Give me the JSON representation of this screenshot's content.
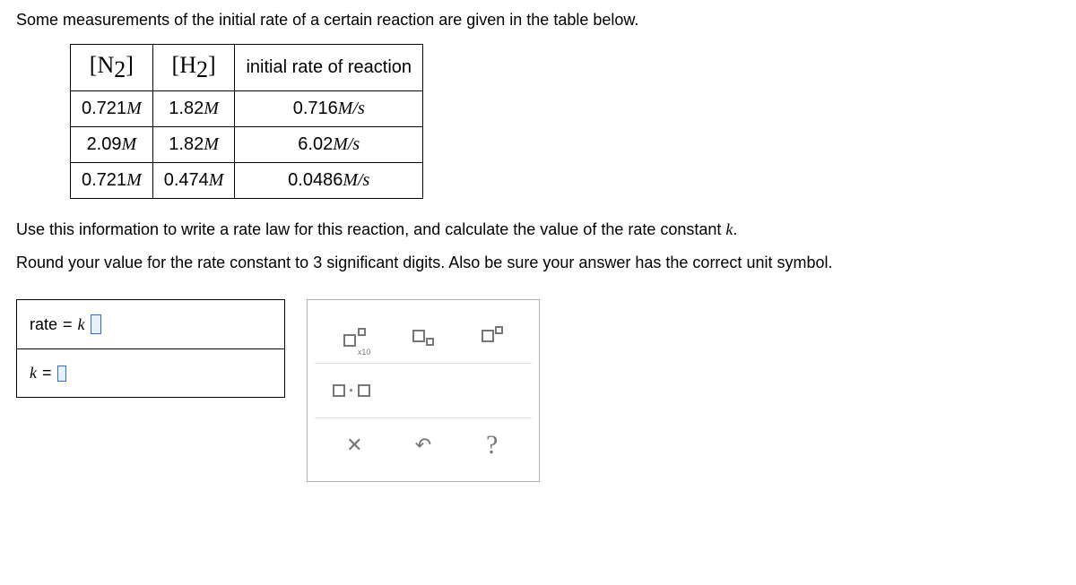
{
  "intro": "Some measurements of the initial rate of a certain reaction are given in the table below.",
  "table": {
    "headers": {
      "n2": "N",
      "n2_sub": "2",
      "h2": "H",
      "h2_sub": "2",
      "rate": "initial rate of reaction"
    },
    "rows": [
      {
        "n2": "0.721",
        "n2_unit": "M",
        "h2": "1.82",
        "h2_unit": "M",
        "rate": "0.716",
        "rate_unit": "M/s"
      },
      {
        "n2": "2.09",
        "n2_unit": "M",
        "h2": "1.82",
        "h2_unit": "M",
        "rate": "6.02",
        "rate_unit": "M/s"
      },
      {
        "n2": "0.721",
        "n2_unit": "M",
        "h2": "0.474",
        "h2_unit": "M",
        "rate": "0.0486",
        "rate_unit": "M/s"
      }
    ]
  },
  "prompt1_a": "Use this information to write a rate law for this reaction, and calculate the value of the rate constant ",
  "prompt1_k": "k",
  "prompt1_b": ".",
  "prompt2": "Round your value for the rate constant to 3 significant digits. Also be sure your answer has the correct unit symbol.",
  "answer": {
    "rate_label": "rate",
    "equals": "=",
    "k_sym": "k",
    "k_label": "k"
  },
  "palette": {
    "x10": "x10"
  }
}
